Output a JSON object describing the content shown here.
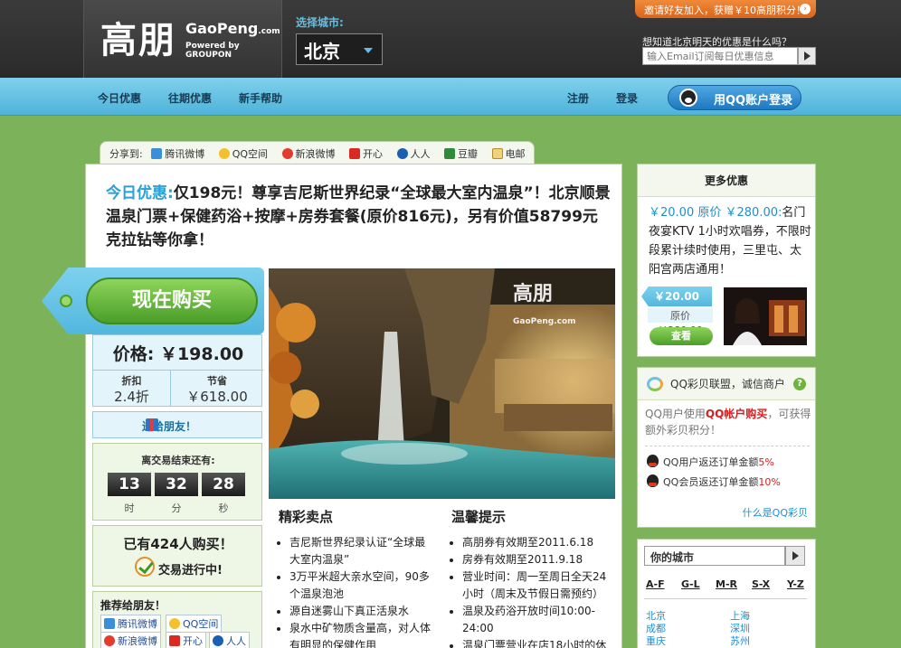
{
  "header": {
    "logo_cn": "高朋",
    "logo_en": "GaoPeng",
    "logo_en_suffix": ".com",
    "logo_powered": "Powered by GROUPON",
    "city_label": "选择城市:",
    "city_value": "北京",
    "invite_text": "邀请好友加入，获赠￥10高朋积分！",
    "subscribe_label": "想知道北京明天的优惠是什么吗？",
    "subscribe_placeholder": "输入Email订阅每日优惠信息"
  },
  "nav": {
    "items": [
      "今日优惠",
      "往期优惠",
      "新手帮助"
    ],
    "register": "注册",
    "login": "登录",
    "qq_login": "用QQ账户登录"
  },
  "share": {
    "label": "分享到:",
    "items": [
      "腾讯微博",
      "QQ空间",
      "新浪微博",
      "开心",
      "人人",
      "豆瓣",
      "电邮"
    ]
  },
  "deal": {
    "title_prefix": "今日优惠:",
    "title_body": "仅198元！尊享吉尼斯世界纪录“全球最大室内温泉”！北京顺景温泉门票+保健药浴+按摩+房券套餐(原价816元)，另有价值58799元克拉钻等你拿！",
    "buy_label": "现在购买",
    "price_label": "价格:",
    "price_value": "￥198.00",
    "discount_label": "折扣",
    "discount_value": "2.4折",
    "save_label": "节省",
    "save_value": "￥618.00",
    "gift_label": "送给朋友！",
    "timer_title": "离交易结束还有:",
    "timer": {
      "hours": "13",
      "minutes": "32",
      "seconds": "28",
      "hours_unit": "时",
      "minutes_unit": "分",
      "seconds_unit": "秒"
    },
    "sold_text": "已有424人购买！",
    "status_text": "交易进行中!",
    "recommend_title": "推荐给朋友！",
    "recommend_items": [
      "腾讯微博",
      "QQ空间",
      "新浪微博",
      "开心",
      "人人"
    ],
    "image_watermark": "高朋",
    "image_watermark_en": "GaoPeng.com",
    "highlights_title": "精彩卖点",
    "highlights": [
      "吉尼斯世界纪录认证“全球最大室内温泉”",
      "3万平米超大亲水空间，90多个温泉泡池",
      "源自迷雾山下真正活泉水",
      "泉水中矿物质含量高，对人体有明显的保健作用"
    ],
    "tips_title": "温馨提示",
    "tips": [
      "高朋券有效期至2011.6.18",
      "房券有效期至2011.9.18",
      "营业时间：周一至周日全天24小时（周末及节假日需预约）",
      "温泉及药浴开放时间10:00-24:00",
      "温泉门票营业在店18小时的休"
    ]
  },
  "sidebar": {
    "more_title": "更多优惠",
    "more_price": "￥20.00",
    "more_orig_label": "原价",
    "more_orig_price": "￥280.00:",
    "more_desc": "名门夜宴KTV 1小时欢唱券，不限时段累计续时使用，三里屯、太阳宫两店通用！",
    "tag_price": "￥20.00",
    "tag_orig": "原价 ￥280.00",
    "view_button": "查看",
    "caibei_title": "QQ彩贝联盟，诚信商户",
    "caibei_desc_a": "QQ用户使用",
    "caibei_desc_b": "QQ帐户购买",
    "caibei_desc_c": "，可获得额外彩贝积分！",
    "caibei_item1_a": "QQ用户返还订单金额",
    "caibei_item1_b": "5%",
    "caibei_item2_a": "QQ会员返还订单金额",
    "caibei_item2_b": "10%",
    "caibei_link": "什么是QQ彩贝",
    "your_city": "你的城市",
    "letters": [
      "A-F",
      "G-L",
      "M-R",
      "S-X",
      "Y-Z"
    ],
    "cities_left": [
      "北京",
      "成都",
      "重庆"
    ],
    "cities_right": [
      "上海",
      "深圳",
      "苏州"
    ]
  },
  "colors": {
    "accent_blue": "#2aa0d4",
    "buy_green": "#4a9e2a",
    "page_green": "#7cb35a",
    "invite_orange": "#e8741f"
  }
}
